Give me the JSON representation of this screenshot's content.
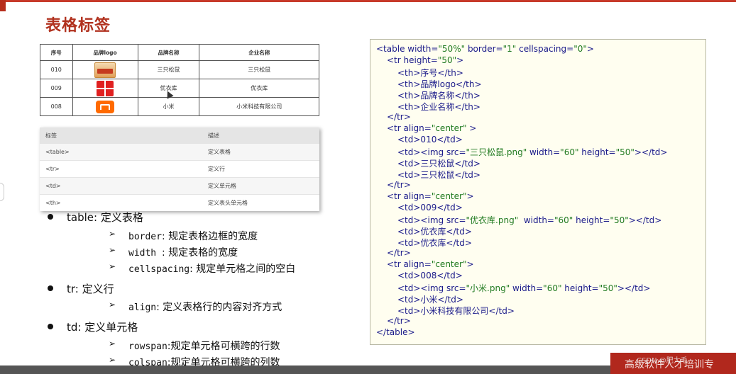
{
  "title": "表格标签",
  "brand_table": {
    "headers": [
      "序号",
      "品牌logo",
      "品牌名称",
      "企业名称"
    ],
    "rows": [
      {
        "id": "010",
        "logo": "three-squirrels-logo",
        "brand": "三只松鼠",
        "company": "三只松鼠"
      },
      {
        "id": "009",
        "logo": "uniqlo-logo",
        "brand": "优衣库",
        "company": "优衣库"
      },
      {
        "id": "008",
        "logo": "xiaomi-logo",
        "brand": "小米",
        "company": "小米科技有限公司"
      }
    ]
  },
  "tag_table": {
    "headers": [
      "标签",
      "描述"
    ],
    "rows": [
      {
        "tag": "<table>",
        "desc": "定义表格"
      },
      {
        "tag": "<tr>",
        "desc": "定义行"
      },
      {
        "tag": "<td>",
        "desc": "定义单元格"
      },
      {
        "tag": "<th>",
        "desc": "定义表头单元格"
      }
    ]
  },
  "bullets": [
    {
      "term": "table",
      "desc": ": 定义表格",
      "subs": [
        {
          "code": "border",
          "desc": ": 规定表格边框的宽度"
        },
        {
          "code": "width ",
          "desc": ": 规定表格的宽度"
        },
        {
          "code": "cellspacing",
          "desc": ": 规定单元格之间的空白"
        }
      ]
    },
    {
      "term": "tr",
      "desc": ": 定义行",
      "subs": [
        {
          "code": "align",
          "desc": ": 定义表格行的内容对齐方式"
        }
      ]
    },
    {
      "term": "td",
      "desc": ": 定义单元格",
      "subs": [
        {
          "code": "rowspan",
          "desc": ":规定单元格可横跨的行数"
        },
        {
          "code": "colspan",
          "desc": ":规定单元格可横跨的列数"
        }
      ]
    }
  ],
  "code_lines": [
    "<table width=\"50%\" border=\"1\" cellspacing=\"0\">",
    "<tr height=\"50\">",
    "<th>序号</th>",
    "<th>品牌logo</th>",
    "<th>品牌名称</th>",
    "<th>企业名称</th>",
    "</tr>",
    "<tr align=\"center\" >",
    "<td>010</td>",
    "<td><img src=\"三只松鼠.png\" width=\"60\" height=\"50\"></td>",
    "<td>三只松鼠</td>",
    "<td>三只松鼠</td>",
    "</tr>",
    "<tr align=\"center\">",
    "<td>009</td>",
    "<td><img src=\"优衣库.png\"  width=\"60\" height=\"50\"></td>",
    "<td>优衣库</td>",
    "<td>优衣库</td>",
    "</tr>",
    "<tr align=\"center\">",
    "<td>008</td>",
    "<td><img src=\"小米.png\" width=\"60\" height=\"50\"></td>",
    "<td>小米</td>",
    "<td>小米科技有限公司</td>",
    "</tr>",
    "</table>"
  ],
  "footer": {
    "label": "高级软件人才培训专",
    "watermark": "CSDN @肥大毛"
  },
  "colors": {
    "accent": "#b1321f",
    "code_text": "#1b1b8a",
    "code_string": "#207a20",
    "code_bg": "#fffef0"
  }
}
